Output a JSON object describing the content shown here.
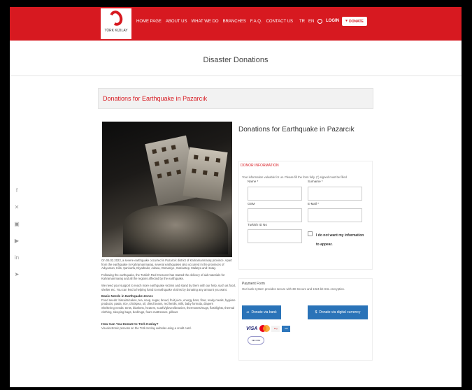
{
  "header": {
    "logo_text": "TÜRK KIZILAY",
    "nav": [
      "HOME PAGE",
      "ABOUT US",
      "WHAT WE DO",
      "BRANCHES",
      "F.A.Q.",
      "CONTACT US"
    ],
    "lang": [
      "TR",
      "EN"
    ],
    "login_label": "LOGIN",
    "donate_label": "DONATE"
  },
  "page_title": "Disaster Donations",
  "section_title": "Donations for Earthquake in Pazarcık",
  "article": {
    "p1": "On 06.02.2023, a severe earthquake occurred in Pazarcık district of Kahramanmaraş province. Apart from the earthquake in Kahramanmaraş, several earthquakes also occurred in the provinces of Adıyaman, Kilis, Şanlıurfa, Diyarbakır, Adana, Osmaniye, Gaziantep, Malatya and Hatay.",
    "p2": "Following the earthquake, the Turkish Red Crescent has started the delivery of aid materials for Kahramanmaraş and all the regions affected by the earthquake.",
    "p3": "We need your support to reach more earthquake victims and stand by them with our help, such as food, shelter etc. You can lend a helping hand to earthquake victims by donating any amount you want.",
    "needs_title": "Basic Needs in Earthquake Zones",
    "needs_food": "Food needs: biscuits/cakes, tea, soup, sugar, bread, fruit juice, energy bars, flour, ready meals, hygiene products, pasta, rice, chickpea, oil, dried beans, red lentils, milk, baby formula, diapers",
    "needs_shelter": "Sheltering needs: tents, blankets, heaters, scarfs/gloves/beanies, thermoses/mugs, flashlights, thermal clothing, sleeping bags, bed/rugs, foam mattresses, pillows",
    "how_title": "How Can You Donate to Türk Kızılay?",
    "how_text": "Via electronic process on the Türk Kızılay website using a credit card."
  },
  "form": {
    "title": "Donations for Earthquake in Pazarcık",
    "donor_heading": "DONOR INFORMATION",
    "donor_note": "Your information valuable for us. Please fill the form fully. (*) signed must be filled",
    "name_label": "Name *",
    "surname_label": "Surname *",
    "gsm_label": "GSM",
    "email_label": "E-Mail *",
    "tc_label": "Turkish ID No",
    "anon_label": "I do not want my information to appear."
  },
  "payment": {
    "heading": "Payment Form",
    "note": "Our bank system provides secure with 3D Secure and 1024-bit SSL encryption.",
    "bank_button": "Donate via bank",
    "crypto_button": "Donate via digital currency",
    "visa": "VISA",
    "secure_badge": "SECURE"
  },
  "colors": {
    "brand_red": "#d71920",
    "button_blue": "#2a73b8"
  },
  "social_icons": [
    "facebook-icon",
    "twitter-icon",
    "instagram-icon",
    "youtube-icon",
    "linkedin-icon",
    "telegram-icon"
  ]
}
